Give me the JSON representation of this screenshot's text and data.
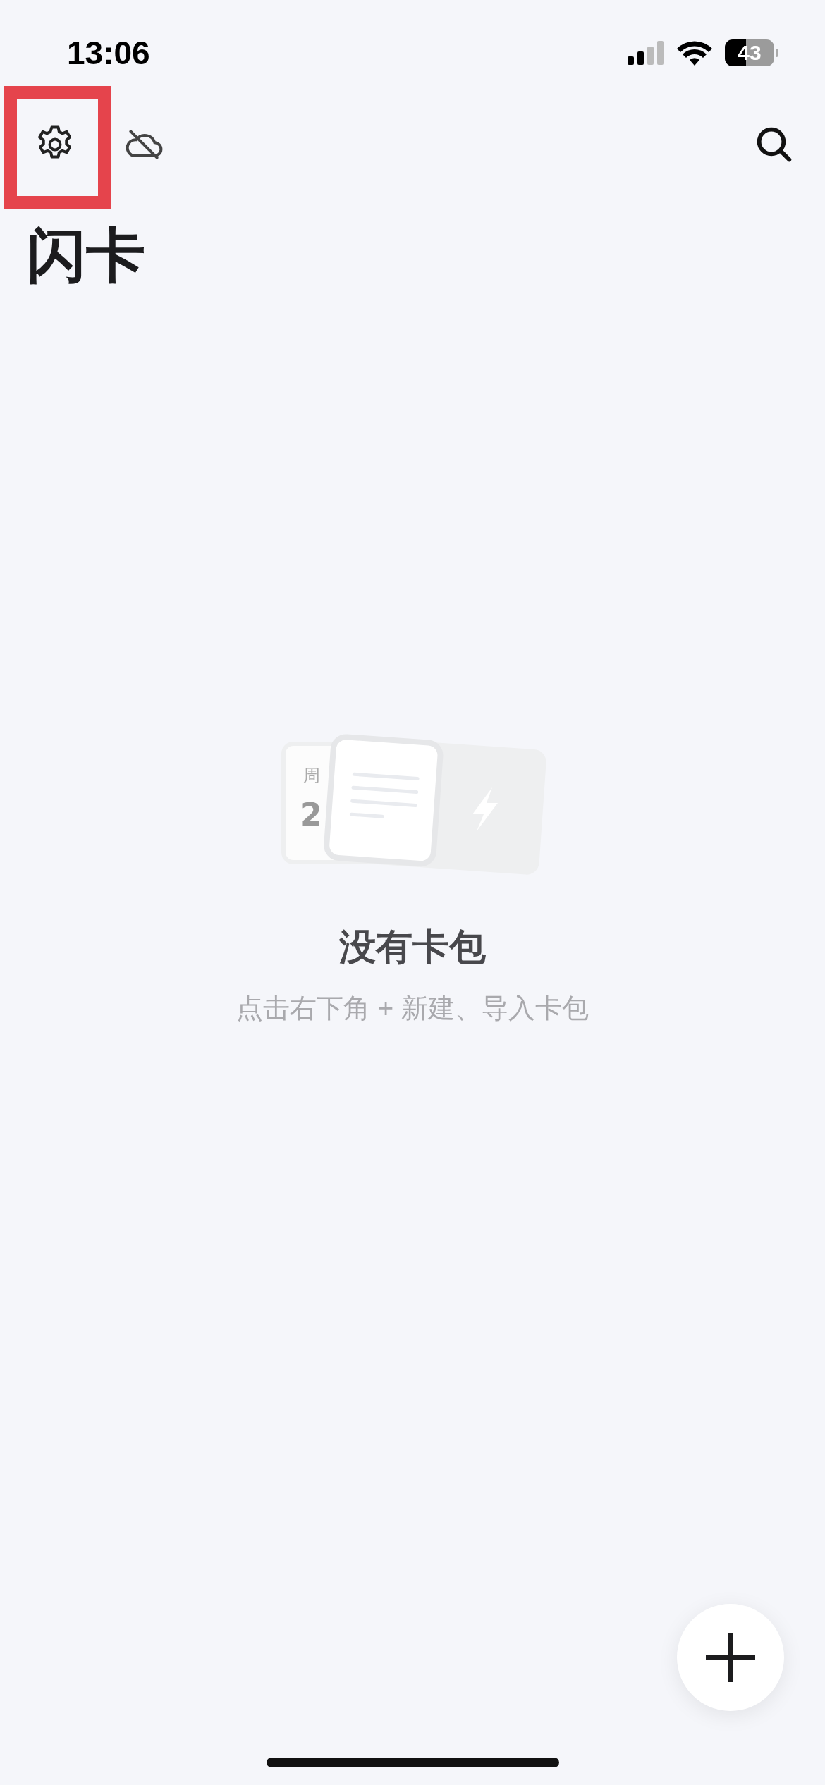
{
  "status_bar": {
    "time": "13:06",
    "battery": "43"
  },
  "toolbar": {
    "buttons": [
      {
        "kind": "settings"
      },
      {
        "kind": "cloud-off"
      },
      {
        "kind": "search"
      }
    ]
  },
  "annotation": {
    "kind": "highlight-box"
  },
  "title": "闪卡",
  "empty_state": {
    "calendar_weekday": "周",
    "calendar_date": "2",
    "heading": "没有卡包",
    "hint": "点击右下角 + 新建、导入卡包"
  },
  "fab": {
    "kind": "add"
  }
}
